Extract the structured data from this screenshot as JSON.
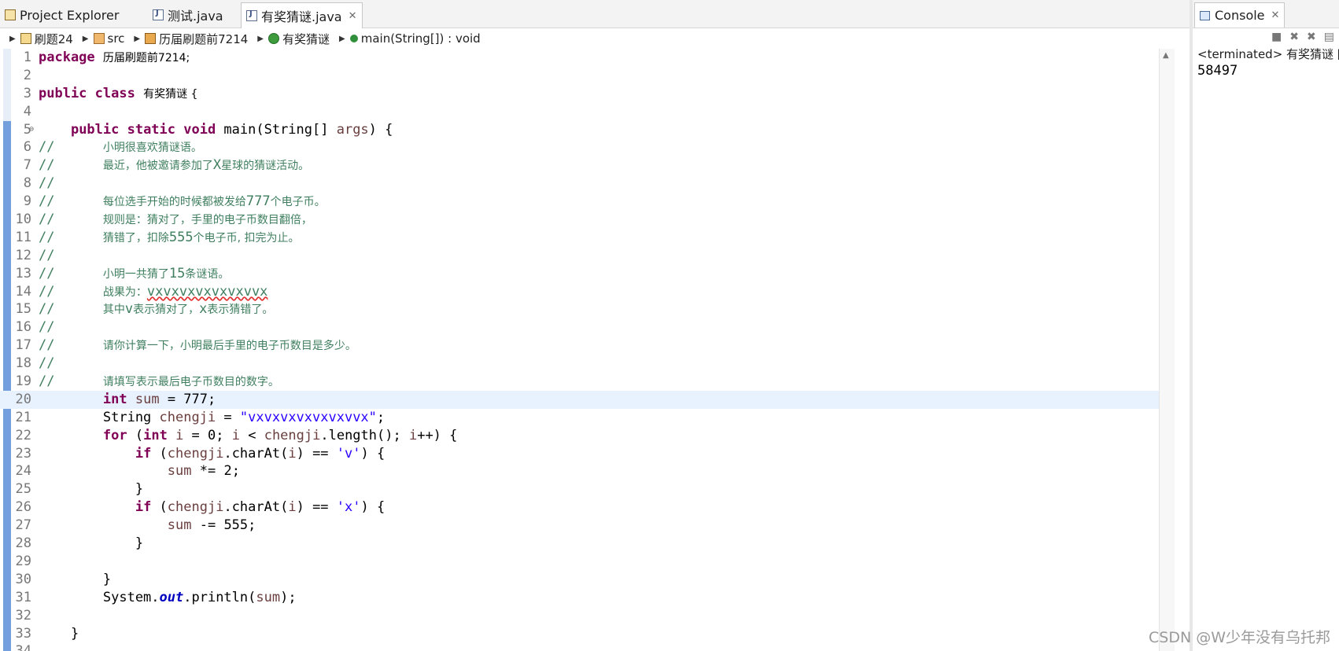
{
  "tabs": [
    {
      "label": "Project Explorer",
      "icon": "project-explorer-icon",
      "active": false
    },
    {
      "label": "测试.java",
      "icon": "java-file-icon",
      "active": false
    },
    {
      "label": "有奖猜谜.java",
      "icon": "java-file-icon",
      "active": true,
      "close": "✕"
    }
  ],
  "breadcrumb": [
    {
      "label": "刷题24",
      "icon": "project-icon"
    },
    {
      "label": "src",
      "icon": "source-folder-icon"
    },
    {
      "label": "历届刷题前7214",
      "icon": "package-icon"
    },
    {
      "label": "有奖猜谜",
      "icon": "class-icon"
    },
    {
      "label": "main(String[]) : void",
      "icon": "method-icon"
    }
  ],
  "code": {
    "l1_pkg": "历届刷题前7214;",
    "l3_cls": "有奖猜谜 {",
    "l6": "小明很喜欢猜谜语。",
    "l7a": "最近，他被邀请参加了",
    "l7b": "X",
    "l7c": "星球的猜谜活动。",
    "l9a": "每位选手开始的时候都被发给",
    "l9b": "777",
    "l9c": "个电子币。",
    "l10": "规则是：猜对了，手里的电子币数目翻倍，",
    "l11a": "猜错了，扣除",
    "l11b": "555",
    "l11c": "个电子币, 扣完为止。",
    "l13a": "小明一共猜了",
    "l13b": "15",
    "l13c": "条谜语。",
    "l14a": "战果为：",
    "l14b": "vxvxvxvxvxvxvvx",
    "l15a": "其中",
    "l15b": "v",
    "l15c": "表示猜对了，",
    "l15d": "x",
    "l15e": "表示猜错了。",
    "l17": "请你计算一下，小明最后手里的电子币数目是多少。",
    "l19": "请填写表示最后电子币数目的数字。",
    "l20_val": "777",
    "l21_str": "\"vxvxvxvxvxvxvvx\"",
    "l23_ch": "'v'",
    "l24_val": "2",
    "l26_ch": "'x'",
    "l27_val": "555"
  },
  "console": {
    "tab_label": "Console",
    "status": "<terminated> 有奖猜谜 [J",
    "output": "58497"
  },
  "watermark": "CSDN @W少年没有乌托邦"
}
